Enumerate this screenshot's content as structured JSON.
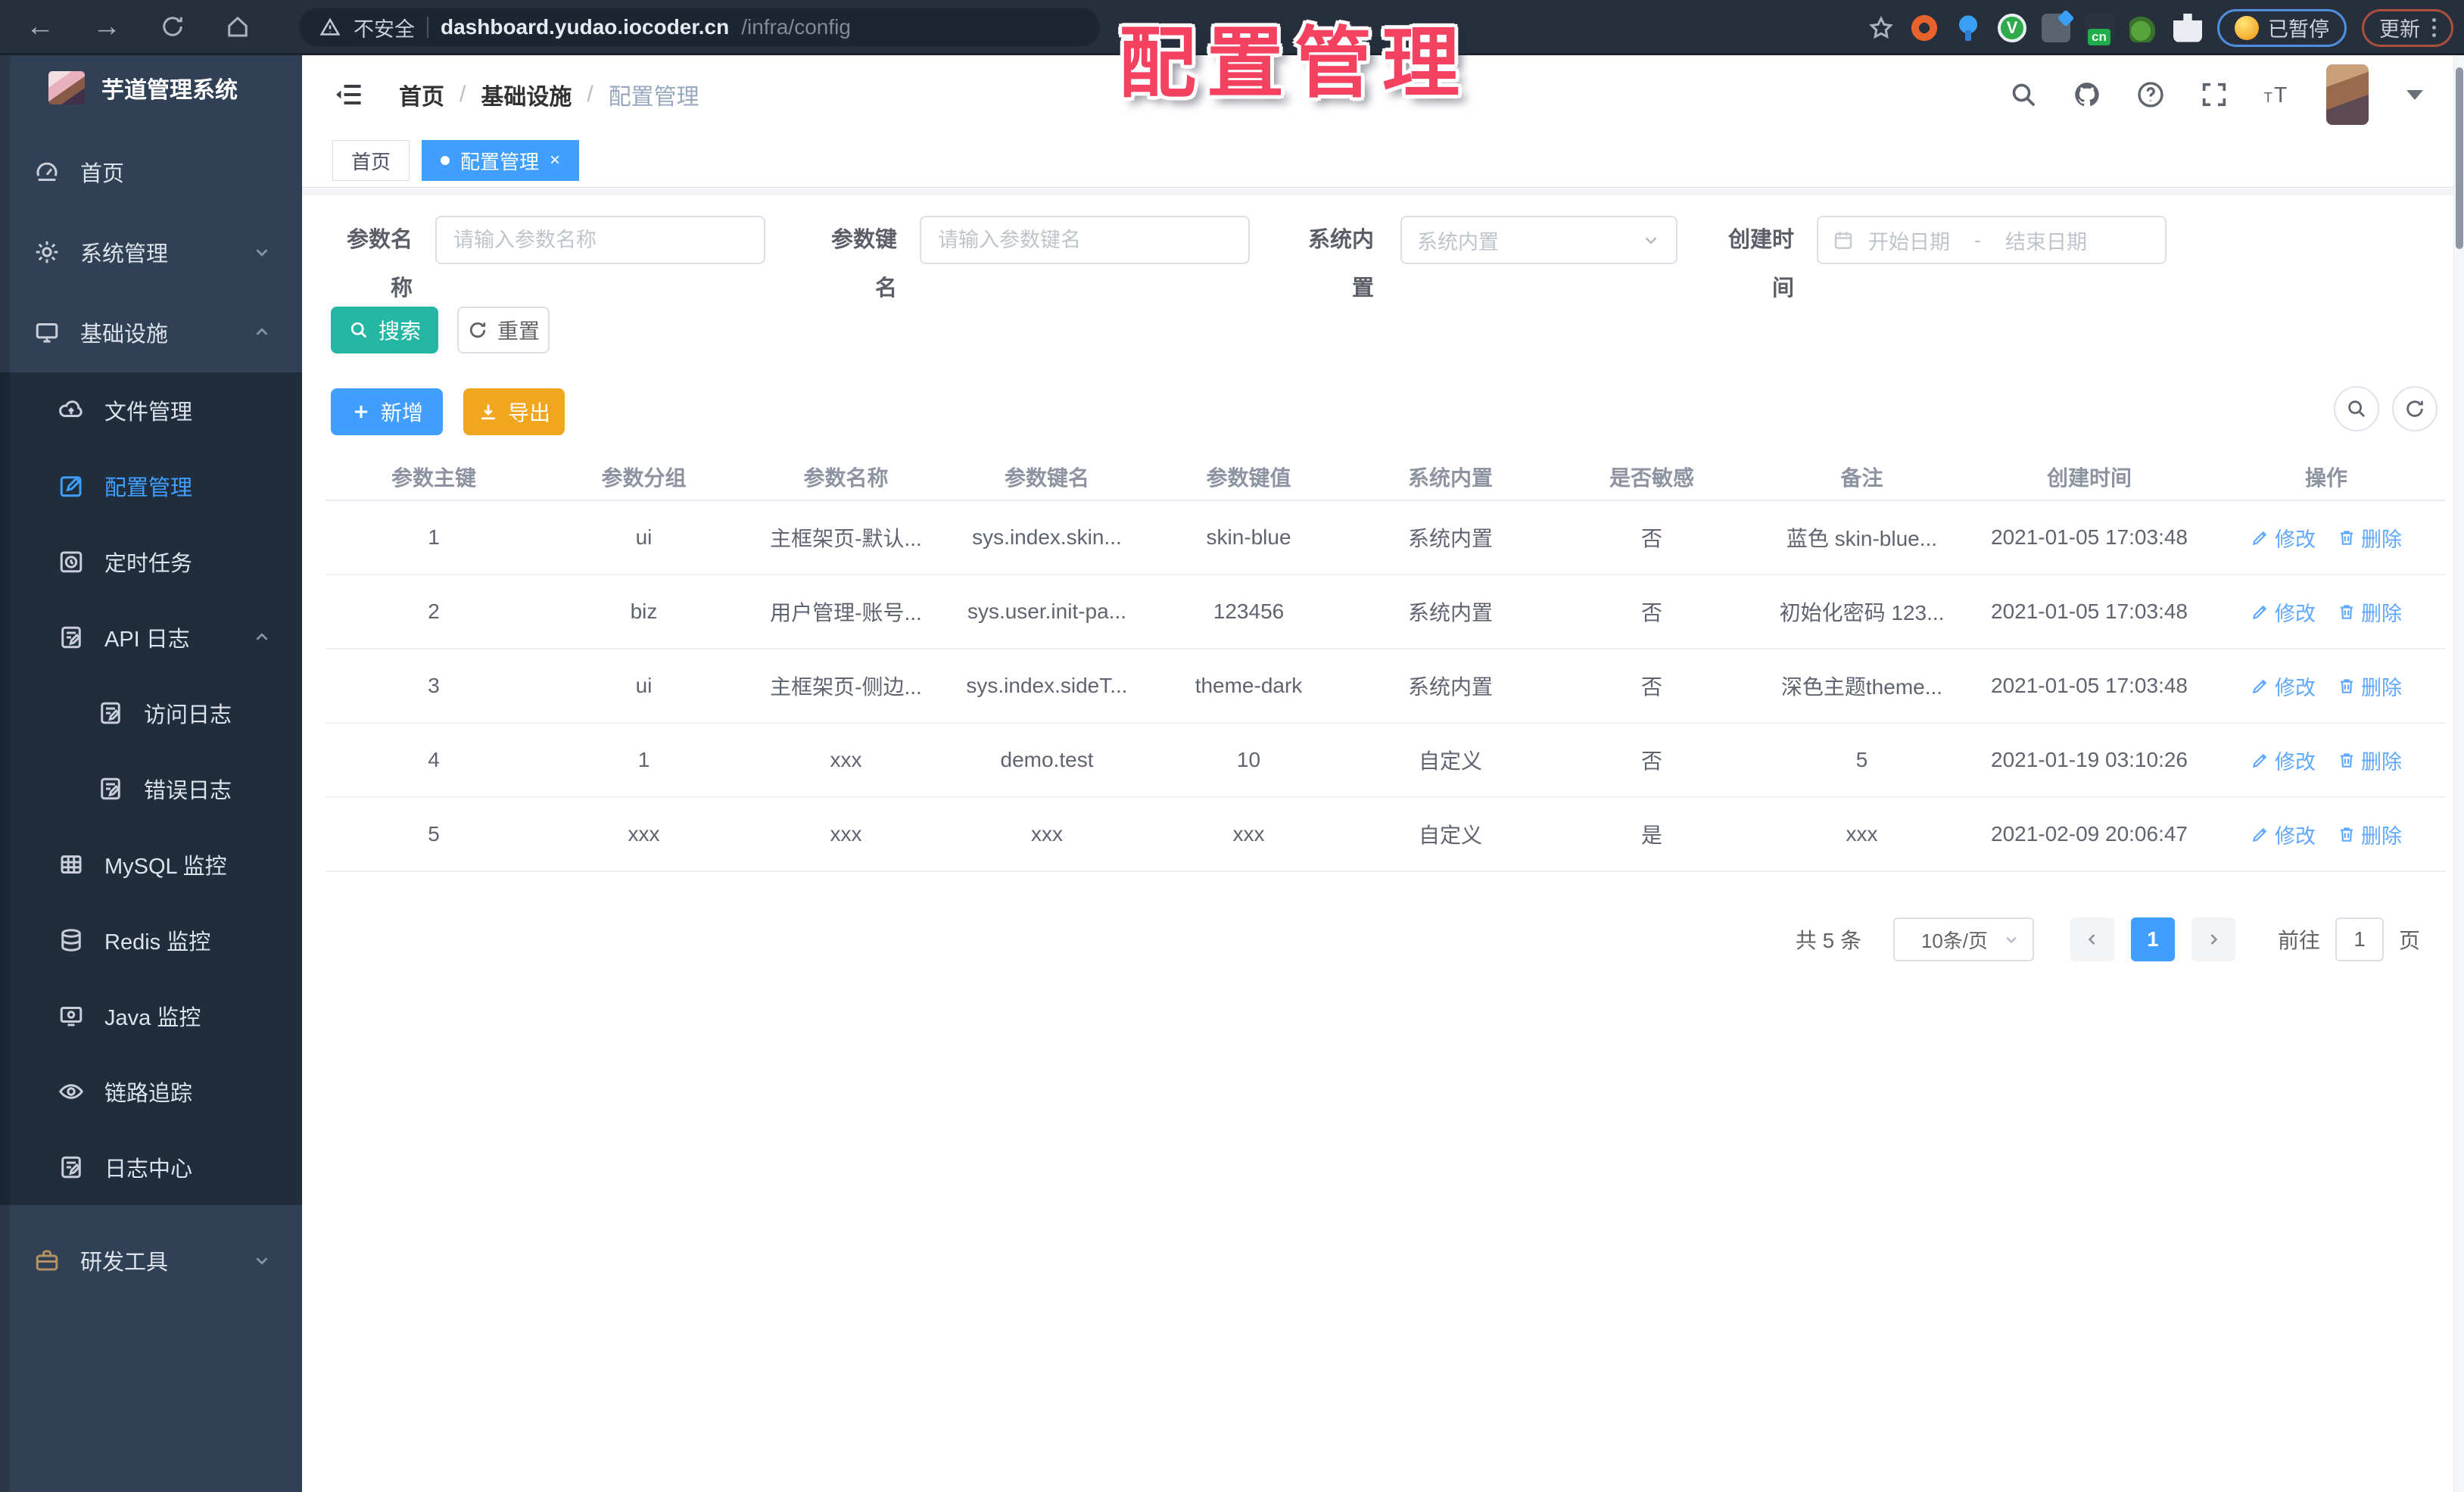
{
  "browser": {
    "security_label": "不安全",
    "url_host": "dashboard.yudao.iocoder.cn",
    "url_path": "/infra/config",
    "paused_badge": "已暂停",
    "update_button": "更新"
  },
  "overlay_title": "配置管理",
  "app": {
    "title": "芋道管理系统"
  },
  "sidebar": {
    "items": [
      {
        "label": "首页"
      },
      {
        "label": "系统管理"
      },
      {
        "label": "基础设施"
      },
      {
        "label": "文件管理"
      },
      {
        "label": "配置管理"
      },
      {
        "label": "定时任务"
      },
      {
        "label": "API 日志"
      },
      {
        "label": "访问日志"
      },
      {
        "label": "错误日志"
      },
      {
        "label": "MySQL 监控"
      },
      {
        "label": "Redis 监控"
      },
      {
        "label": "Java 监控"
      },
      {
        "label": "链路追踪"
      },
      {
        "label": "日志中心"
      },
      {
        "label": "研发工具"
      }
    ]
  },
  "breadcrumb": {
    "items": [
      "首页",
      "基础设施",
      "配置管理"
    ],
    "separator": "/"
  },
  "tabs": [
    {
      "label": "首页"
    },
    {
      "label": "配置管理"
    }
  ],
  "filters": {
    "name_label": "参数名称",
    "name_placeholder": "请输入参数名称",
    "key_label": "参数键名",
    "key_placeholder": "请输入参数键名",
    "type_label": "系统内置",
    "type_placeholder": "系统内置",
    "date_label": "创建时间",
    "date_start_placeholder": "开始日期",
    "date_separator": "-",
    "date_end_placeholder": "结束日期",
    "search_button": "搜索",
    "reset_button": "重置"
  },
  "toolbar": {
    "add_button": "新增",
    "export_button": "导出"
  },
  "table": {
    "columns": [
      "参数主键",
      "参数分组",
      "参数名称",
      "参数键名",
      "参数键值",
      "系统内置",
      "是否敏感",
      "备注",
      "创建时间",
      "操作"
    ],
    "edit_action": "修改",
    "delete_action": "删除",
    "rows": [
      {
        "id": "1",
        "group": "ui",
        "name": "主框架页-默认...",
        "key": "sys.index.skin...",
        "value": "skin-blue",
        "type": "系统内置",
        "sensitive": "否",
        "remark": "蓝色 skin-blue...",
        "created": "2021-01-05 17:03:48"
      },
      {
        "id": "2",
        "group": "biz",
        "name": "用户管理-账号...",
        "key": "sys.user.init-pa...",
        "value": "123456",
        "type": "系统内置",
        "sensitive": "否",
        "remark": "初始化密码 123...",
        "created": "2021-01-05 17:03:48"
      },
      {
        "id": "3",
        "group": "ui",
        "name": "主框架页-侧边...",
        "key": "sys.index.sideT...",
        "value": "theme-dark",
        "type": "系统内置",
        "sensitive": "否",
        "remark": "深色主题theme...",
        "created": "2021-01-05 17:03:48"
      },
      {
        "id": "4",
        "group": "1",
        "name": "xxx",
        "key": "demo.test",
        "value": "10",
        "type": "自定义",
        "sensitive": "否",
        "remark": "5",
        "created": "2021-01-19 03:10:26"
      },
      {
        "id": "5",
        "group": "xxx",
        "name": "xxx",
        "key": "xxx",
        "value": "xxx",
        "type": "自定义",
        "sensitive": "是",
        "remark": "xxx",
        "created": "2021-02-09 20:06:47"
      }
    ]
  },
  "pagination": {
    "total_text": "共 5 条",
    "page_size": "10条/页",
    "current_page": "1",
    "goto_label": "前往",
    "goto_value": "1",
    "page_suffix": "页"
  },
  "colors": {
    "accent": "#409eff",
    "success": "#23b7a4",
    "warning": "#f0a71f",
    "sidebar": "#304156",
    "submenu": "#1f2d3d",
    "overlay": "#f4415f"
  }
}
